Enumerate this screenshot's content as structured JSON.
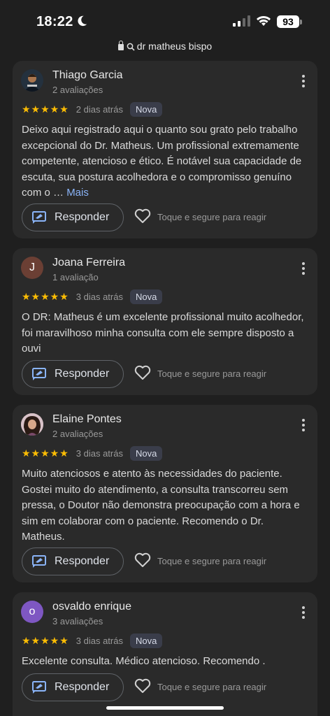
{
  "status": {
    "time": "18:22",
    "battery": "93"
  },
  "url": {
    "text": "dr matheus bispo"
  },
  "colors": {
    "star": "#fbbc04",
    "link": "#8ab4f8",
    "card": "#2a2a2a",
    "background": "#1f1f1f"
  },
  "actions": {
    "reply_label": "Responder",
    "react_hint": "Toque e segure para reagir",
    "badge": "Nova",
    "more": "Mais"
  },
  "reviews": [
    {
      "name": "Thiago Garcia",
      "count": "2 avaliações",
      "stars": "★★★★★",
      "when": "2 dias atrás",
      "text": "Deixo aqui registrado aqui o quanto sou grato pelo trabalho excepcional do Dr. Matheus. Um profissional extremamente competente, atencioso e ético. É notável sua capacidade de escuta, sua postura acolhedora e o compromisso genuíno com o … ",
      "avatar": "photo"
    },
    {
      "name": "Joana Ferreira",
      "count": "1 avaliação",
      "stars": "★★★★★",
      "when": "3 dias atrás",
      "text": "O DR: Matheus é um excelente profissional muito acolhedor, foi maravilhoso minha consulta com ele sempre disposto a ouvi",
      "avatar_letter": "J",
      "avatar_color": "#6b3f34"
    },
    {
      "name": "Elaine Pontes",
      "count": "2 avaliações",
      "stars": "★★★★★",
      "when": "3 dias atrás",
      "text": "Muito atenciosos e atento às necessidades do paciente. Gostei muito do atendimento, a consulta transcorreu sem pressa, o Doutor não demonstra preocupação com a hora e sim em colaborar com o paciente. Recomendo o Dr. Matheus.",
      "avatar": "photo"
    },
    {
      "name": "osvaldo enrique",
      "count": "3 avaliações",
      "stars": "★★★★★",
      "when": "3 dias atrás",
      "text": "Excelente consulta. Médico atencioso. Recomendo .",
      "avatar_letter": "o",
      "avatar_color": "#7e57c2"
    }
  ]
}
